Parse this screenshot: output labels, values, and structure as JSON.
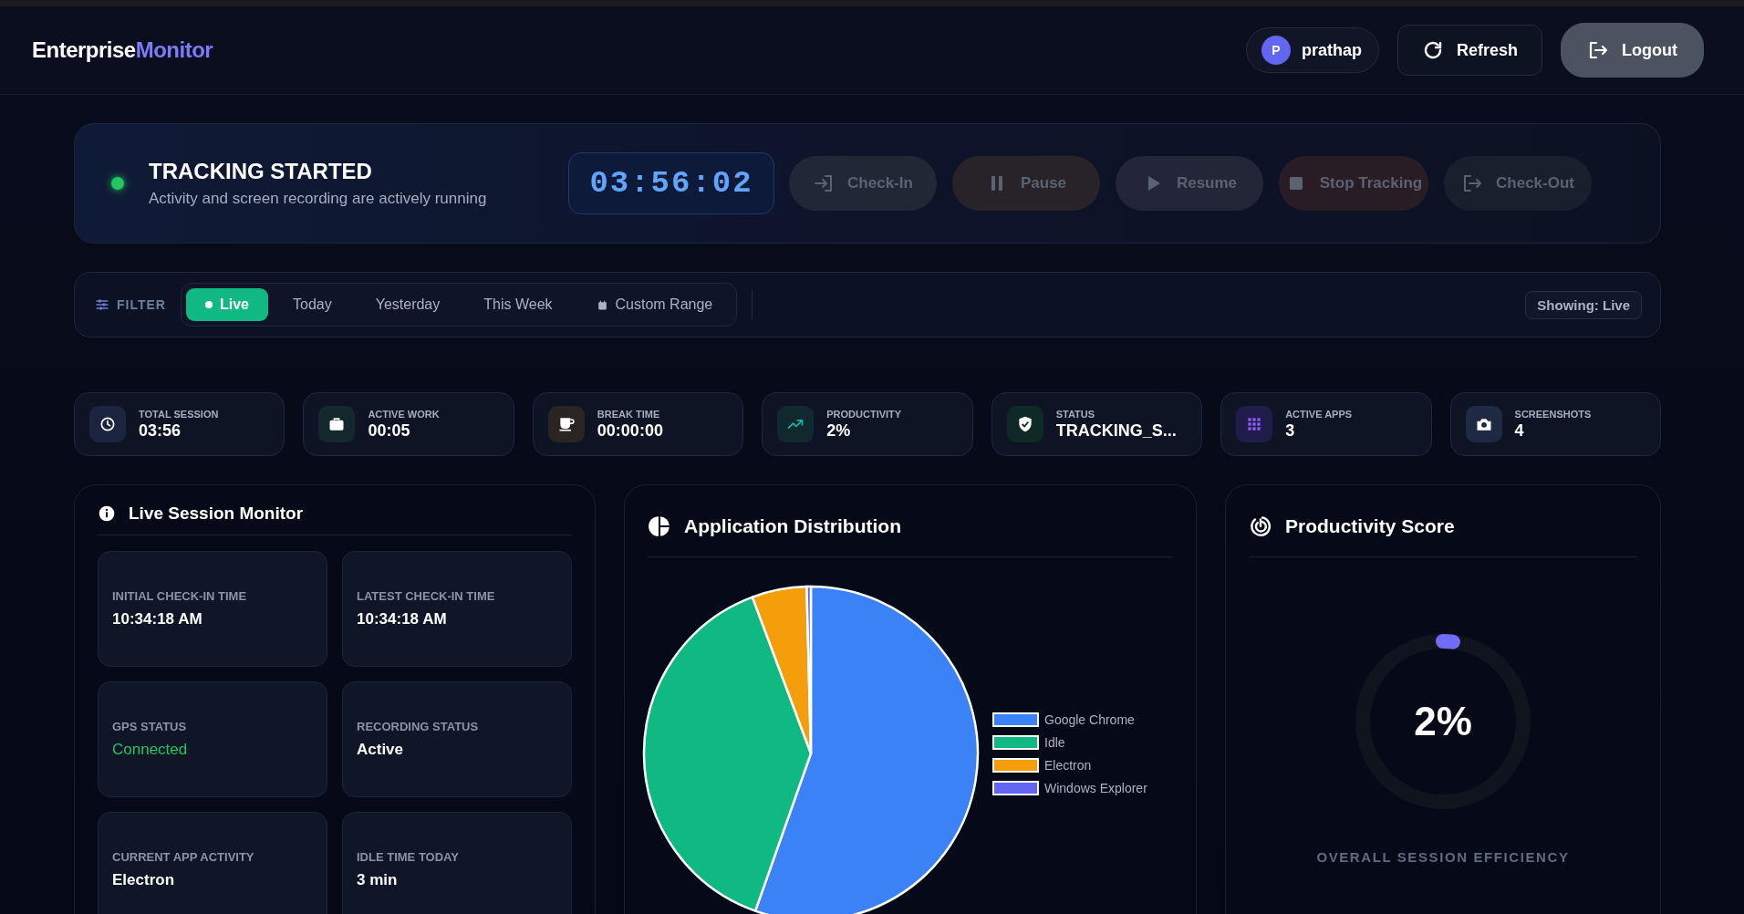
{
  "header": {
    "logo": {
      "primary": "Enterprise",
      "accent": "Monitor"
    },
    "user": {
      "initial": "P",
      "name": "prathap"
    },
    "buttons": [
      {
        "label": "Refresh",
        "kind": "refresh"
      },
      {
        "label": "Logout",
        "kind": "logout"
      }
    ]
  },
  "tracking": {
    "active": true,
    "title": "TRACKING STARTED",
    "subtitle": "Activity and screen recording are actively running",
    "timer": "03:56:02",
    "actions": [
      {
        "label": "Check-In",
        "kind": "checkin",
        "disabled": true
      },
      {
        "label": "Pause",
        "kind": "pause",
        "disabled": true
      },
      {
        "label": "Resume",
        "kind": "resume",
        "disabled": true
      },
      {
        "label": "Stop Tracking",
        "kind": "stop",
        "disabled": true
      },
      {
        "label": "Check-Out",
        "kind": "checkout",
        "disabled": true
      }
    ]
  },
  "filter": {
    "label": "FILTER",
    "options": [
      {
        "label": "Live",
        "kind": "live",
        "selected": true
      },
      {
        "label": "Today",
        "kind": "preset",
        "selected": false
      },
      {
        "label": "Yesterday",
        "kind": "preset",
        "selected": false
      },
      {
        "label": "This Week",
        "kind": "preset",
        "selected": false
      },
      {
        "label": "Custom Range",
        "kind": "custom",
        "selected": false
      }
    ],
    "showing": "Showing: Live"
  },
  "stats": [
    {
      "kind": "clock",
      "label": "TOTAL SESSION",
      "value": "03:56"
    },
    {
      "kind": "briefcase",
      "label": "ACTIVE WORK",
      "value": "00:05"
    },
    {
      "kind": "cup",
      "label": "BREAK TIME",
      "value": "00:00:00"
    },
    {
      "kind": "trend",
      "label": "PRODUCTIVITY",
      "value": "2%"
    },
    {
      "kind": "shield",
      "label": "STATUS",
      "value": "TRACKING_S..."
    },
    {
      "kind": "grid",
      "label": "ACTIVE APPS",
      "value": "3"
    },
    {
      "kind": "camera",
      "label": "SCREENSHOTS",
      "value": "4"
    }
  ],
  "live_session_monitor": {
    "title": "Live Session Monitor",
    "items": [
      {
        "label": "INITIAL CHECK-IN TIME",
        "value": "10:34:18 AM",
        "highlight": false
      },
      {
        "label": "LATEST CHECK-IN TIME",
        "value": "10:34:18 AM",
        "highlight": false
      },
      {
        "label": "GPS STATUS",
        "value": "Connected",
        "highlight": true
      },
      {
        "label": "RECORDING STATUS",
        "value": "Active",
        "highlight": false
      },
      {
        "label": "CURRENT APP ACTIVITY",
        "value": "Electron",
        "highlight": false
      },
      {
        "label": "IDLE TIME TODAY",
        "value": "3 min",
        "highlight": false
      }
    ]
  },
  "application_distribution": {
    "title": "Application Distribution",
    "chart_data": {
      "type": "pie",
      "categories": [
        "Google Chrome",
        "Idle",
        "Electron",
        "Windows Explorer"
      ],
      "values": [
        55.4,
        38.9,
        5.3,
        0.4
      ],
      "colors": [
        "#3b82f6",
        "#10b981",
        "#f59e0b",
        "#6366f1"
      ],
      "legend": "right"
    }
  },
  "productivity_score": {
    "title": "Productivity Score",
    "level": 0.02,
    "reading": "2%",
    "caption": "OVERALL SESSION EFFICIENCY"
  }
}
